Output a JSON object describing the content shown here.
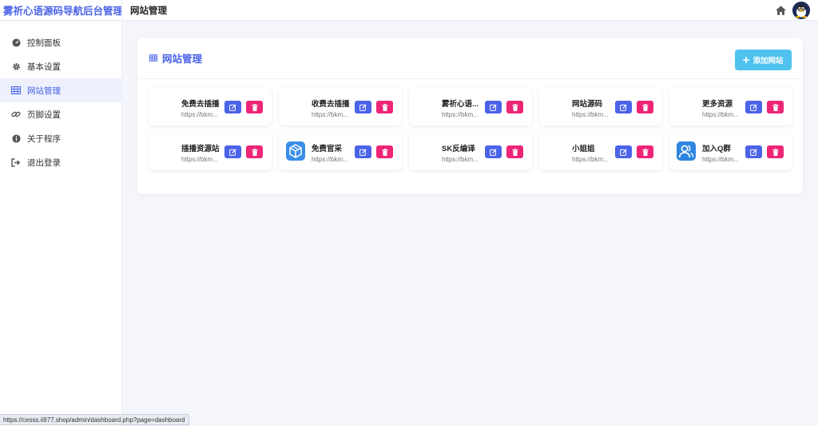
{
  "app": {
    "brand": "雾祈心语源码导航后台管理",
    "page_title": "网站管理"
  },
  "colors": {
    "accent": "#4a63e8",
    "add_button": "#4fc3ee",
    "delete_button": "#ee2577"
  },
  "sidebar": {
    "items": [
      {
        "label": "控制面板",
        "icon": "dashboard-icon",
        "active": false
      },
      {
        "label": "基本设置",
        "icon": "gear-icon",
        "active": false
      },
      {
        "label": "网站管理",
        "icon": "table-icon",
        "active": true
      },
      {
        "label": "页脚设置",
        "icon": "link-icon",
        "active": false
      },
      {
        "label": "关于程序",
        "icon": "info-icon",
        "active": false
      },
      {
        "label": "退出登录",
        "icon": "logout-icon",
        "active": false
      }
    ]
  },
  "card": {
    "title": "网站管理",
    "add_button_label": "添加网站"
  },
  "sites": [
    {
      "name": "免费去插播",
      "url": "https://bkm...",
      "logo": ""
    },
    {
      "name": "收费去插播",
      "url": "https://bkm...",
      "logo": ""
    },
    {
      "name": "雾祈心语...",
      "url": "https://bkm...",
      "logo": ""
    },
    {
      "name": "网站源码",
      "url": "https://bkm...",
      "logo": ""
    },
    {
      "name": "更多资源",
      "url": "https://bkm...",
      "logo": ""
    },
    {
      "name": "插播资源站",
      "url": "https://bkm...",
      "logo": ""
    },
    {
      "name": "免费官采",
      "url": "https://bkm...",
      "logo": "cube-logo-icon"
    },
    {
      "name": "SK反编译",
      "url": "https://bkm...",
      "logo": ""
    },
    {
      "name": "小姐姐",
      "url": "https://bkm...",
      "logo": ""
    },
    {
      "name": "加入Q群",
      "url": "https://bkm...",
      "logo": "users-logo-icon"
    }
  ],
  "statusbar": {
    "url": "https://cesss.ii977.shop/admin/dashboard.php?page=dashboard"
  }
}
